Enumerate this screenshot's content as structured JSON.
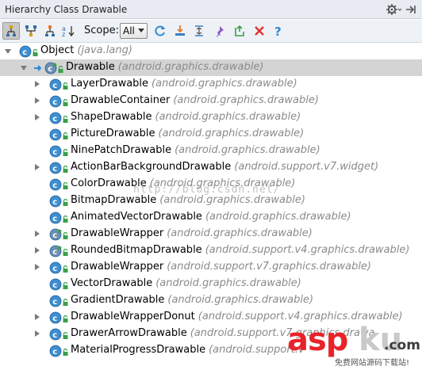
{
  "window": {
    "title": "Hierarchy Class Drawable"
  },
  "toolbar": {
    "scope_label": "Scope:",
    "scope_value": "All",
    "buttons": [
      "subtypes-hierarchy-icon",
      "supertypes-hierarchy-icon",
      "class-hierarchy-icon",
      "sort-alphabetically-icon",
      "refresh-icon",
      "export-icon",
      "expand-all-icon",
      "pin-icon",
      "autoscroll-icon",
      "close-icon",
      "help-icon"
    ]
  },
  "tree": [
    {
      "name": "Object",
      "pkg": "(java.lang)",
      "level": 0,
      "toggle": "expanded",
      "selected": false,
      "icon": "class-icon"
    },
    {
      "name": "Drawable",
      "pkg": "(android.graphics.drawable)",
      "level": 1,
      "toggle": "expanded",
      "selected": true,
      "icon": "abstract-class-icon"
    },
    {
      "name": "LayerDrawable",
      "pkg": "(android.graphics.drawable)",
      "level": 2,
      "toggle": "collapsed",
      "icon": "class-icon"
    },
    {
      "name": "DrawableContainer",
      "pkg": "(android.graphics.drawable)",
      "level": 2,
      "toggle": "collapsed",
      "icon": "class-icon"
    },
    {
      "name": "ShapeDrawable",
      "pkg": "(android.graphics.drawable)",
      "level": 2,
      "toggle": "collapsed",
      "icon": "class-icon"
    },
    {
      "name": "PictureDrawable",
      "pkg": "(android.graphics.drawable)",
      "level": 2,
      "toggle": "none",
      "icon": "class-icon"
    },
    {
      "name": "NinePatchDrawable",
      "pkg": "(android.graphics.drawable)",
      "level": 2,
      "toggle": "none",
      "icon": "class-icon"
    },
    {
      "name": "ActionBarBackgroundDrawable",
      "pkg": "(android.support.v7.widget)",
      "level": 2,
      "toggle": "collapsed",
      "icon": "class-icon"
    },
    {
      "name": "ColorDrawable",
      "pkg": "(android.graphics.drawable)",
      "level": 2,
      "toggle": "none",
      "icon": "class-icon"
    },
    {
      "name": "BitmapDrawable",
      "pkg": "(android.graphics.drawable)",
      "level": 2,
      "toggle": "none",
      "icon": "class-icon"
    },
    {
      "name": "AnimatedVectorDrawable",
      "pkg": "(android.graphics.drawable)",
      "level": 2,
      "toggle": "none",
      "icon": "class-icon"
    },
    {
      "name": "DrawableWrapper",
      "pkg": "(android.graphics.drawable)",
      "level": 2,
      "toggle": "collapsed",
      "icon": "abstract-class-icon"
    },
    {
      "name": "RoundedBitmapDrawable",
      "pkg": "(android.support.v4.graphics.drawable)",
      "level": 2,
      "toggle": "collapsed",
      "icon": "abstract-class-icon"
    },
    {
      "name": "DrawableWrapper",
      "pkg": "(android.support.v7.graphics.drawable)",
      "level": 2,
      "toggle": "collapsed",
      "icon": "class-icon"
    },
    {
      "name": "VectorDrawable",
      "pkg": "(android.graphics.drawable)",
      "level": 2,
      "toggle": "none",
      "icon": "class-icon"
    },
    {
      "name": "GradientDrawable",
      "pkg": "(android.graphics.drawable)",
      "level": 2,
      "toggle": "none",
      "icon": "class-icon"
    },
    {
      "name": "DrawableWrapperDonut",
      "pkg": "(android.support.v4.graphics.drawable)",
      "level": 2,
      "toggle": "collapsed",
      "icon": "class-icon"
    },
    {
      "name": "DrawerArrowDrawable",
      "pkg": "(android.support.v7.graphics.drawa",
      "level": 2,
      "toggle": "collapsed",
      "icon": "class-icon"
    },
    {
      "name": "MaterialProgressDrawable",
      "pkg": "(android.support.v",
      "level": 2,
      "toggle": "none",
      "icon": "class-icon"
    }
  ],
  "watermark": {
    "url_text": "http://blog.csdn.net/",
    "logo_asp": "asp",
    "logo_ku": "ku",
    "logo_com": ".com",
    "logo_sub": "免费网站源码下载站!"
  },
  "colors": {
    "class_icon": "#3d8fd1",
    "abstract_icon": "#6e8fb3",
    "lock": "#3aa04a",
    "selected_row": "#d4d4d4",
    "pkg_text": "#8a8a8a",
    "toolbar_bg": "#eef1f5"
  }
}
